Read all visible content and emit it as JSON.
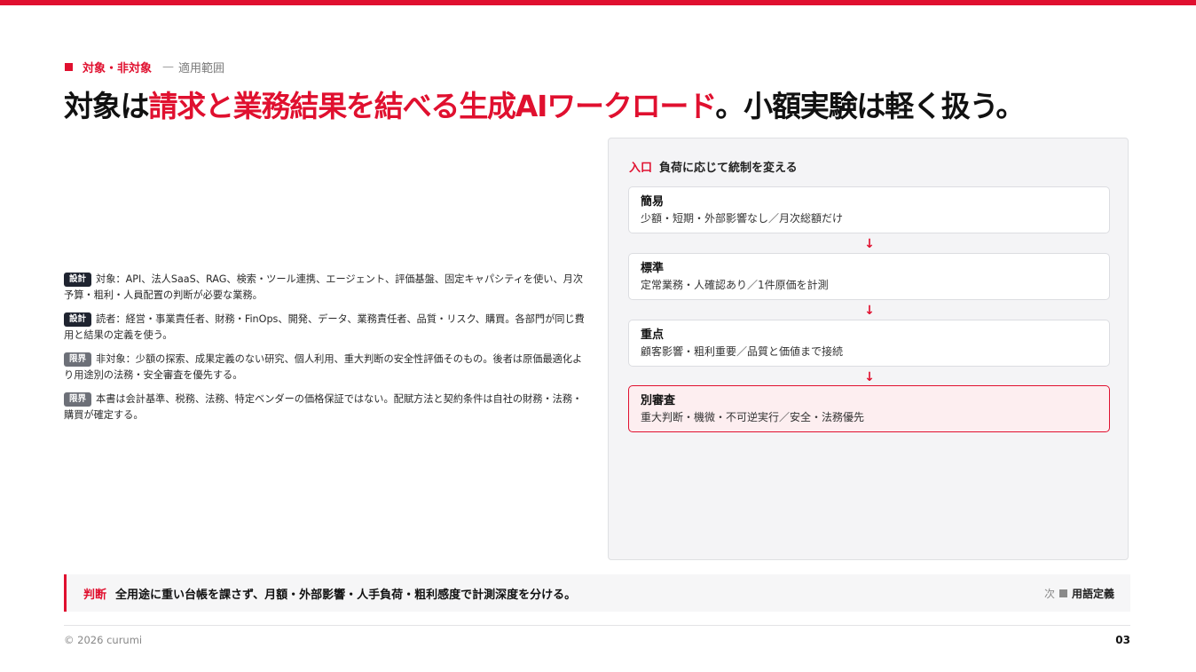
{
  "eyebrow": {
    "label": "対象・非対象",
    "separator": "—",
    "sub": "適用範囲"
  },
  "title": {
    "part1": "対象は",
    "highlight": "請求と業務結果を結べる生成AIワークロード",
    "part2": "。小額実験は軽く扱う。"
  },
  "scope": [
    {
      "badge": "設計",
      "badge_style": "dark",
      "text": "対象：API、法人SaaS、RAG、検索・ツール連携、エージェント、評価基盤、固定キャパシティを使い、月次予算・粗利・人員配置の判断が必要な業務。"
    },
    {
      "badge": "設計",
      "badge_style": "dark",
      "text": "読者：経営・事業責任者、財務・FinOps、開発、データ、業務責任者、品質・リスク、購買。各部門が同じ費用と結果の定義を使う。"
    },
    {
      "badge": "限界",
      "badge_style": "gray",
      "text": "非対象：少額の探索、成果定義のない研究、個人利用、重大判断の安全性評価そのもの。後者は原価最適化より用途別の法務・安全審査を優先する。"
    },
    {
      "badge": "限界",
      "badge_style": "gray",
      "text": "本書は会計基準、税務、法務、特定ベンダーの価格保証ではない。配賦方法と契約条件は自社の財務・法務・購買が確定する。"
    }
  ],
  "panel": {
    "head_label": "入口",
    "head_text": "負荷に応じて統制を変える",
    "arrow": "↓",
    "steps": [
      {
        "name": "簡易",
        "desc": "少額・短期・外部影響なし／月次総額だけ"
      },
      {
        "name": "標準",
        "desc": "定常業務・人確認あり／1件原価を計測"
      },
      {
        "name": "重点",
        "desc": "顧客影響・粗利重要／品質と価値まで接続"
      },
      {
        "name": "別審査",
        "desc": "重大判断・機微・不可逆実行／安全・法務優先"
      }
    ]
  },
  "footer": {
    "key": "判断",
    "text": "全用途に重い台帳を課さず、月額・外部影響・人手負荷・粗利感度で計測深度を分ける。",
    "next_prefix": "次",
    "next_label": "用語定義"
  },
  "copyright": "© 2026 curumi",
  "page_number": "03",
  "colors": {
    "accent": "#e0102f",
    "badge_dark": "#1f2430",
    "badge_gray": "#6d7078",
    "panel_bg": "#f4f4f6"
  }
}
